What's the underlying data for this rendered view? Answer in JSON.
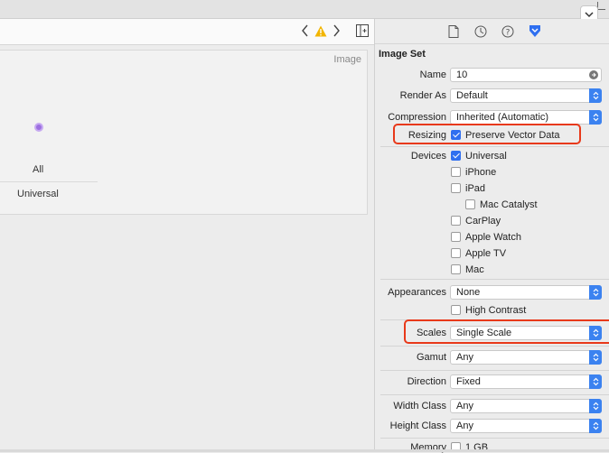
{
  "editor": {
    "canvas_title": "Image",
    "idiom_label": "All",
    "universal_label": "Universal"
  },
  "inspector": {
    "section_title": "Image Set",
    "name": {
      "label": "Name",
      "value": "10"
    },
    "render_as": {
      "label": "Render As",
      "value": "Default"
    },
    "compression": {
      "label": "Compression",
      "value": "Inherited (Automatic)"
    },
    "resizing": {
      "label": "Resizing",
      "option": "Preserve Vector Data",
      "checked": true
    },
    "devices": {
      "label": "Devices",
      "items": [
        {
          "label": "Universal",
          "checked": true
        },
        {
          "label": "iPhone",
          "checked": false
        },
        {
          "label": "iPad",
          "checked": false
        },
        {
          "label": "Mac Catalyst",
          "checked": false
        },
        {
          "label": "CarPlay",
          "checked": false
        },
        {
          "label": "Apple Watch",
          "checked": false
        },
        {
          "label": "Apple TV",
          "checked": false
        },
        {
          "label": "Mac",
          "checked": false
        }
      ]
    },
    "appearances": {
      "label": "Appearances",
      "value": "None"
    },
    "high_contrast": {
      "label": "High Contrast",
      "checked": false
    },
    "scales": {
      "label": "Scales",
      "value": "Single Scale"
    },
    "gamut": {
      "label": "Gamut",
      "value": "Any"
    },
    "direction": {
      "label": "Direction",
      "value": "Fixed"
    },
    "width_class": {
      "label": "Width Class",
      "value": "Any"
    },
    "height_class": {
      "label": "Height Class",
      "value": "Any"
    },
    "memory": {
      "label": "Memory",
      "option": "1 GB",
      "checked": false
    }
  },
  "colors": {
    "highlight": "#e8391a",
    "accent": "#2f6ff0",
    "warning": "#f2b500"
  },
  "icons": [
    "chevron-left-icon",
    "warning-icon",
    "chevron-right-icon",
    "add-editor-icon",
    "file-inspector-icon",
    "history-inspector-icon",
    "help-inspector-icon",
    "attributes-inspector-icon",
    "chevron-down-icon",
    "vector-dot-icon"
  ]
}
